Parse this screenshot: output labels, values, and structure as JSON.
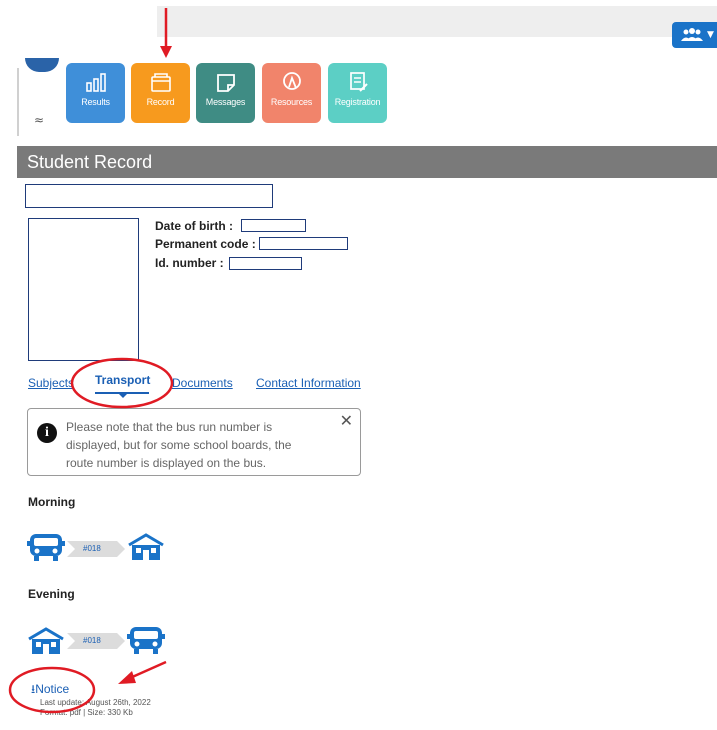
{
  "topbar": {
    "user_menu_icon": "users-icon"
  },
  "tiles": [
    {
      "label": "Results",
      "icon": "bar-chart-icon",
      "color": "#3f8fd9"
    },
    {
      "label": "Record",
      "icon": "folder-icon",
      "color": "#f79a1e"
    },
    {
      "label": "Messages",
      "icon": "note-icon",
      "color": "#3f8c84"
    },
    {
      "label": "Resources",
      "icon": "resources-icon",
      "color": "#f1846b"
    },
    {
      "label": "Registration",
      "icon": "registration-icon",
      "color": "#5ccfc5"
    }
  ],
  "record": {
    "title": "Student Record",
    "dob_label": "Date of birth :",
    "permanent_code_label": "Permanent code :",
    "id_label": "Id. number :"
  },
  "tabs": {
    "subjects": "Subjects",
    "transport": "Transport",
    "documents": "Documents",
    "contact": "Contact Information"
  },
  "notice_box": {
    "text": "Please note that the bus run number is displayed, but for some school boards, the route number is displayed on the bus."
  },
  "transport": {
    "morning_label": "Morning",
    "morning_run": "#018",
    "evening_label": "Evening",
    "evening_run": "#018"
  },
  "notice": {
    "link_label": "Notice",
    "updated_prefix": "Last update: ",
    "updated_value": "August 26th, 2022",
    "format_line": "Format: pdf | Size: 330 Kb"
  },
  "colors": {
    "accent": "#1a5fb4",
    "header": "#7a7a7a",
    "annotation": "#e01b24"
  }
}
